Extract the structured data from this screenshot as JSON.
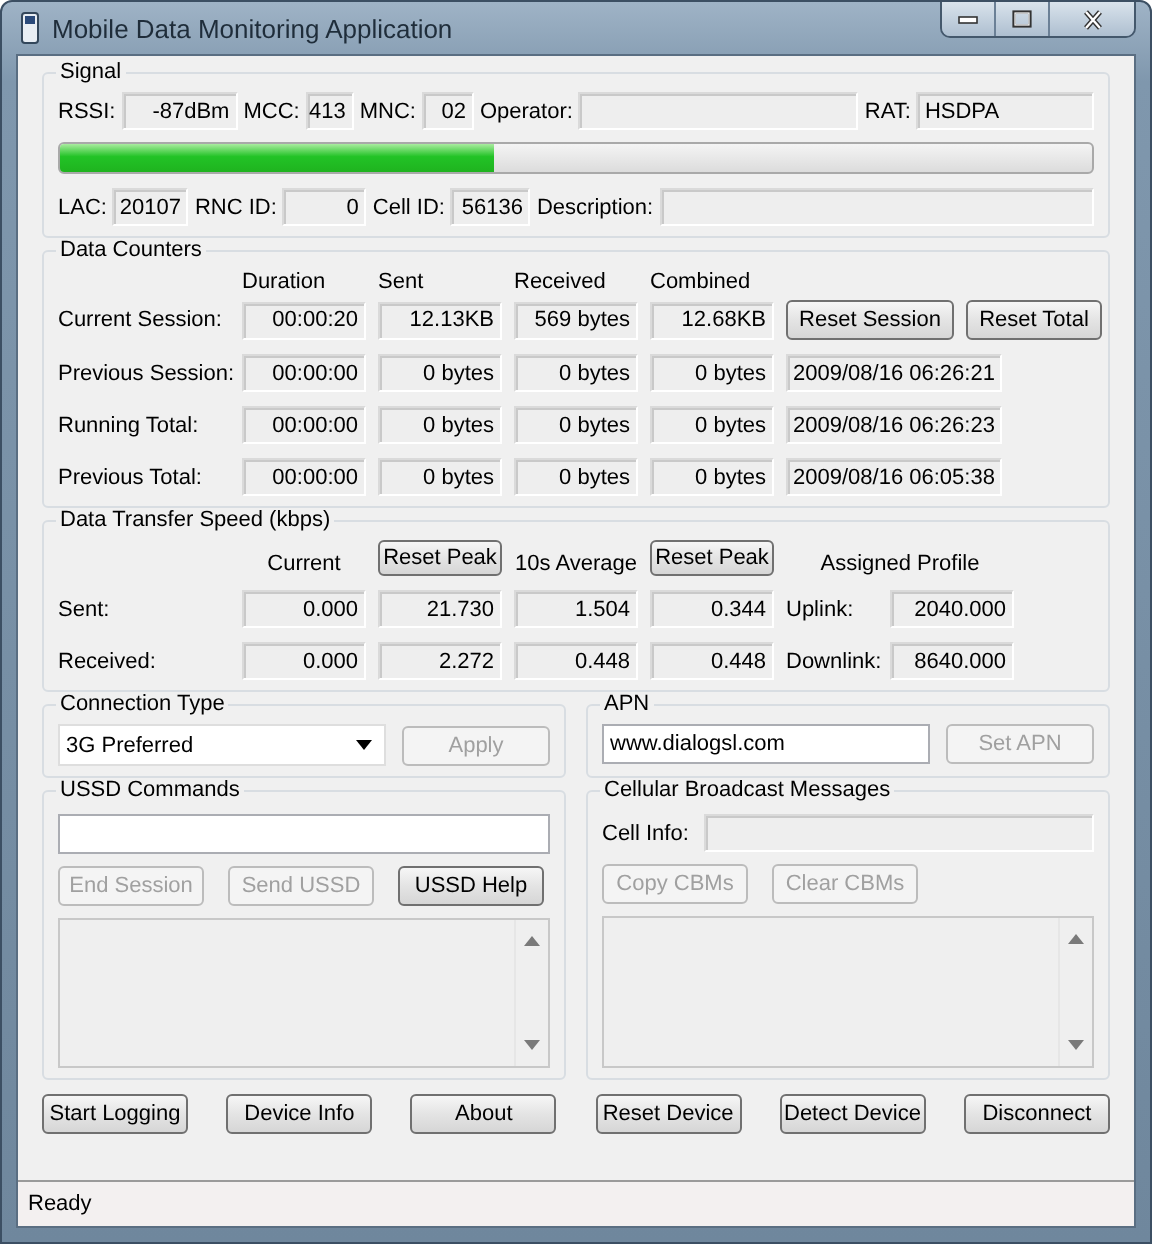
{
  "window": {
    "title": "Mobile Data Monitoring Application"
  },
  "signal": {
    "title": "Signal",
    "row1": [
      {
        "label": "RSSI:",
        "value": "-87dBm"
      },
      {
        "label": "MCC:",
        "value": "413"
      },
      {
        "label": "MNC:",
        "value": "02"
      },
      {
        "label": "Operator:"
      },
      {
        "label": "RAT:",
        "value": "HSDPA"
      }
    ],
    "level": 0.42,
    "row2": [
      {
        "label": "LAC:",
        "value": "20107"
      },
      {
        "label": "RNC ID:",
        "value": "0"
      },
      {
        "label": "Cell ID:",
        "value": "56136"
      },
      {
        "label": "Description:"
      }
    ]
  },
  "data_counters": {
    "title": "Data Counters",
    "columns": [
      "Duration",
      "Sent",
      "Received",
      "Combined"
    ],
    "rows": [
      {
        "label": "Current Session:",
        "values": [
          "00:00:20",
          "12.13KB",
          "569 bytes",
          "12.68KB"
        ],
        "buttons": [
          "Reset Session",
          "Reset Total"
        ]
      },
      {
        "label": "Previous Session:",
        "values": [
          "00:00:00",
          "0 bytes",
          "0 bytes",
          "0 bytes"
        ],
        "timestamp": "2009/08/16 06:26:21"
      },
      {
        "label": "Running Total:",
        "values": [
          "00:00:00",
          "0 bytes",
          "0 bytes",
          "0 bytes"
        ],
        "timestamp": "2009/08/16 06:26:23"
      },
      {
        "label": "Previous Total:",
        "values": [
          "00:00:00",
          "0 bytes",
          "0 bytes",
          "0 bytes"
        ],
        "timestamp": "2009/08/16 06:05:38"
      }
    ]
  },
  "transfer_speed": {
    "title": "Data Transfer Speed (kbps)",
    "headers": [
      {
        "kind": "label",
        "text": "Current"
      },
      {
        "kind": "button",
        "text": "Reset Peak"
      },
      {
        "kind": "label",
        "text": "10s Average"
      },
      {
        "kind": "button",
        "text": "Reset Peak"
      }
    ],
    "profile_header": "Assigned Profile",
    "rows": [
      {
        "label": "Sent:",
        "values": [
          "0.000",
          "21.730",
          "1.504",
          "0.344"
        ],
        "profile_label": "Uplink:",
        "profile_value": "2040.000"
      },
      {
        "label": "Received:",
        "values": [
          "0.000",
          "2.272",
          "0.448",
          "0.448"
        ],
        "profile_label": "Downlink:",
        "profile_value": "8640.000"
      }
    ]
  },
  "connection_type": {
    "title": "Connection Type",
    "value": "3G Preferred",
    "button": {
      "label": "Apply",
      "disabled": true
    }
  },
  "apn": {
    "title": "APN",
    "value": "www.dialogsl.com",
    "button": {
      "label": "Set APN",
      "disabled": true
    }
  },
  "ussd": {
    "title": "USSD Commands",
    "buttons": [
      {
        "label": "End Session",
        "disabled": true
      },
      {
        "label": "Send USSD",
        "disabled": true
      },
      {
        "label": "USSD Help",
        "disabled": false
      }
    ]
  },
  "cbm": {
    "title": "Cellular Broadcast Messages",
    "cell_info_label": "Cell Info:",
    "buttons": [
      {
        "label": "Copy CBMs",
        "disabled": true
      },
      {
        "label": "Clear CBMs",
        "disabled": true
      }
    ]
  },
  "footer_buttons": [
    "Start Logging",
    "Device Info",
    "About",
    "Reset Device",
    "Detect Device",
    "Disconnect"
  ],
  "status_bar": "Ready"
}
